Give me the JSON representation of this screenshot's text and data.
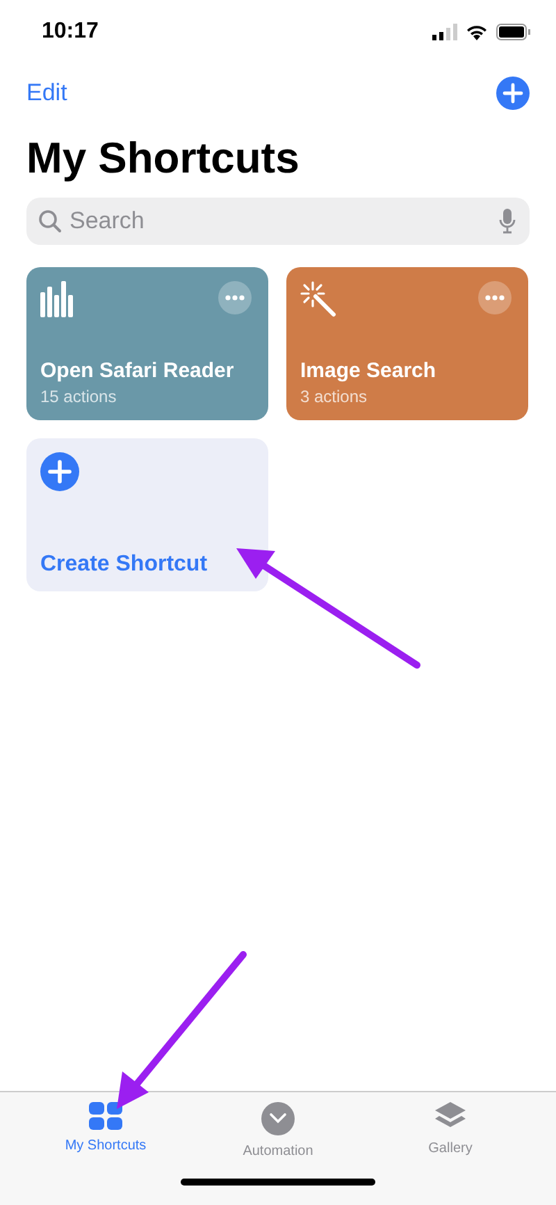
{
  "status_bar": {
    "time": "10:17"
  },
  "nav": {
    "edit": "Edit"
  },
  "title": "My Shortcuts",
  "search": {
    "placeholder": "Search"
  },
  "cards": [
    {
      "kind": "shortcut",
      "name": "Open Safari Reader",
      "subtitle": "15 actions",
      "color": "#6a98a8"
    },
    {
      "kind": "shortcut",
      "name": "Image Search",
      "subtitle": "3 actions",
      "color": "#cf7c48"
    },
    {
      "kind": "create",
      "name": "Create Shortcut"
    }
  ],
  "tab_bar": [
    {
      "label": "My Shortcuts",
      "selected": true
    },
    {
      "label": "Automation",
      "selected": false
    },
    {
      "label": "Gallery",
      "selected": false
    }
  ]
}
